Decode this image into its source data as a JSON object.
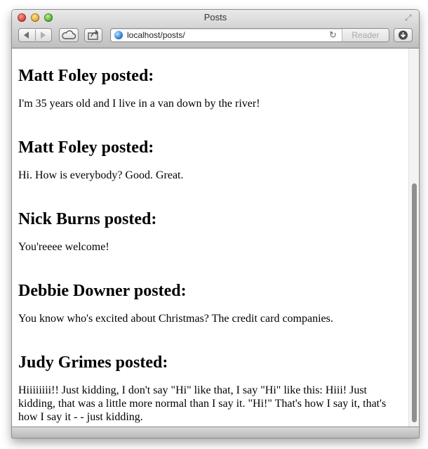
{
  "window": {
    "title": "Posts"
  },
  "toolbar": {
    "url": "localhost/posts/",
    "reader_label": "Reader"
  },
  "posts": [
    {
      "heading": "Matt Foley posted:",
      "body": "I'm 35 years old and I live in a van down by the river!"
    },
    {
      "heading": "Matt Foley posted:",
      "body": "Hi. How is everybody? Good. Great."
    },
    {
      "heading": "Nick Burns posted:",
      "body": "You'reeee welcome!"
    },
    {
      "heading": "Debbie Downer posted:",
      "body": "You know who's excited about Christmas? The credit card companies."
    },
    {
      "heading": "Judy Grimes posted:",
      "body": "Hiiiiiiii!! Just kidding, I don't say \"Hi\" like that, I say \"Hi\" like this: Hiii! Just kidding, that was a little more normal than I say it. \"Hi!\" That's how I say it, that's how I say it - - just kidding."
    }
  ]
}
